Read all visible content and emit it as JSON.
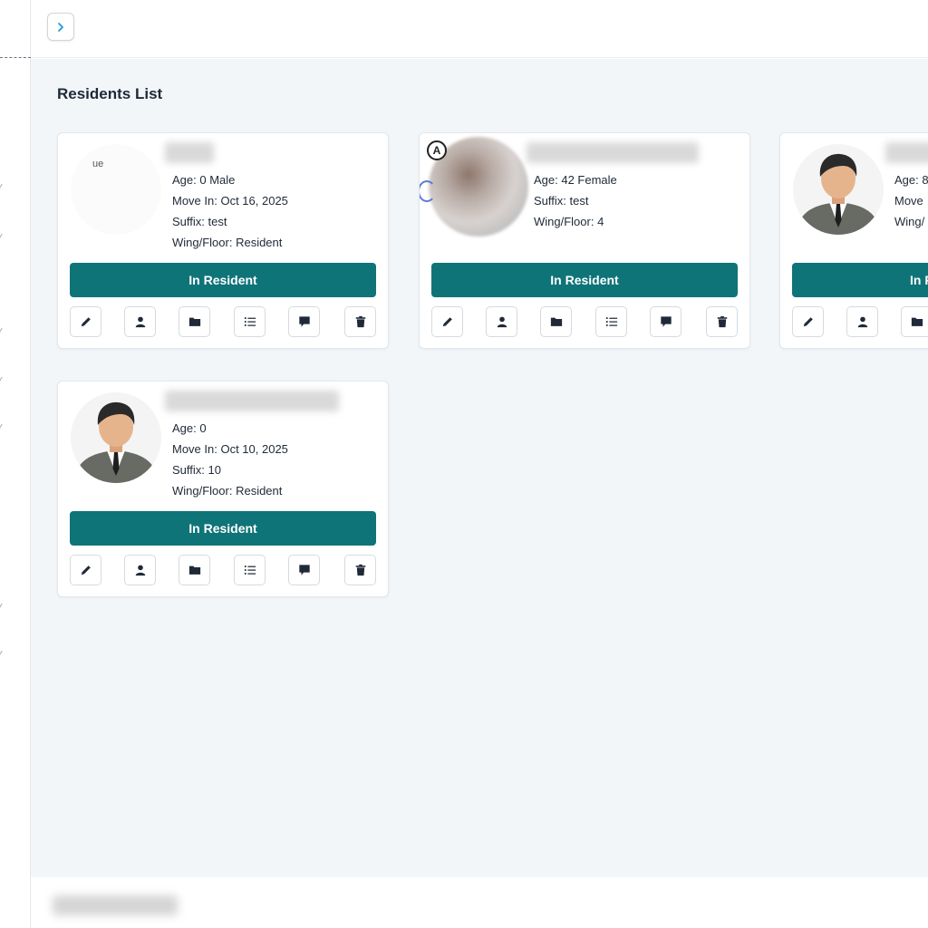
{
  "header": {
    "toggle_icon": "chevron-right-icon"
  },
  "page": {
    "title": "Residents List"
  },
  "colors": {
    "accent": "#0f7478",
    "background": "#f3f6f9"
  },
  "residents": [
    {
      "avatar": "broken-image",
      "avatar_alt_fragment": "ue",
      "age_line": "Age: 0 Male",
      "move_in": "Move In: Oct 16, 2025",
      "suffix": "Suffix: test",
      "wing": "Wing/Floor: Resident",
      "status": "In Resident"
    },
    {
      "avatar": "photo-blurred",
      "badge": "A",
      "age_line": "Age: 42 Female",
      "suffix": "Suffix: test",
      "wing": "Wing/Floor: 4",
      "status": "In Resident"
    },
    {
      "avatar": "male-default",
      "age_line": "Age: 8",
      "move_in": "Move",
      "wing": "Wing/",
      "status": "In R"
    },
    {
      "avatar": "male-default",
      "age_line": "Age: 0",
      "move_in": "Move In: Oct 10, 2025",
      "suffix": "Suffix: 10",
      "wing": "Wing/Floor: Resident",
      "status": "In Resident"
    }
  ],
  "card_actions": [
    "pencil-icon",
    "user-icon",
    "folder-icon",
    "list-icon",
    "comment-icon",
    "trash-icon"
  ]
}
